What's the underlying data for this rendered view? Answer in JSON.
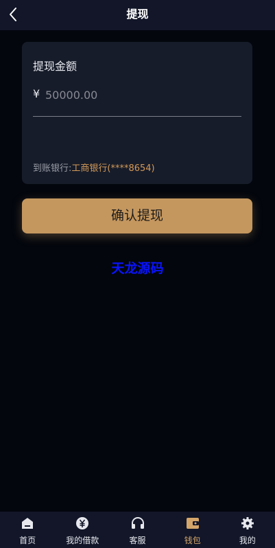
{
  "header": {
    "title": "提现",
    "back_icon": "chevron-left-icon"
  },
  "form": {
    "title": "提现金额",
    "currency_symbol": "¥",
    "amount_value": "",
    "amount_placeholder": "50000.00",
    "bank_label": "到账银行:",
    "bank_value": "工商银行(****8654)"
  },
  "confirm_button": {
    "label": "确认提现"
  },
  "watermark": {
    "text": "天龙源码"
  },
  "tabbar": {
    "items": [
      {
        "label": "首页",
        "icon": "home-icon",
        "active": false
      },
      {
        "label": "我的借款",
        "icon": "yen-coin-icon",
        "active": false
      },
      {
        "label": "客服",
        "icon": "headset-icon",
        "active": false
      },
      {
        "label": "钱包",
        "icon": "wallet-icon",
        "active": true
      },
      {
        "label": "我的",
        "icon": "gear-icon",
        "active": false
      }
    ]
  },
  "colors": {
    "background": "#03060d",
    "header_bg": "#121628",
    "card_bg": "#171c2a",
    "accent": "#c4975f",
    "bank_value": "#d39a58",
    "active_tab": "#d4a56a",
    "watermark": "#0a14ff"
  }
}
